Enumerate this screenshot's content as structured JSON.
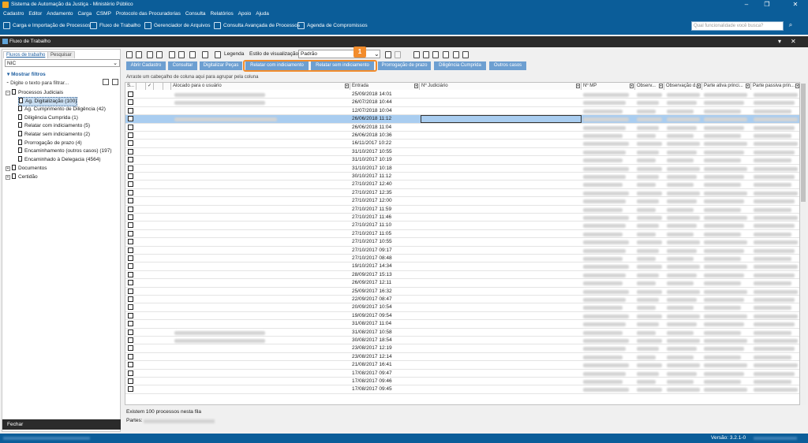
{
  "window": {
    "title": "Sistema de Automação da Justiça - Ministério Público"
  },
  "menu": [
    "Cadastro",
    "Editor",
    "Andamento",
    "Carga",
    "CSMP",
    "Protocolo das Procuradorias",
    "Consulta",
    "Relatórios",
    "Apoio",
    "Ajuda"
  ],
  "toolbar": {
    "items": [
      "Carga e Importação de Processos",
      "Fluxo de Trabalho",
      "Gerenciador de Arquivos",
      "Consulta Avançada de Processos",
      "Agenda de Compromissos"
    ],
    "search_placeholder": "Qual funcionalidade você busca?"
  },
  "panel": {
    "title": "Fluxo de Trabalho"
  },
  "left": {
    "tabs": [
      "Fluxos de trabalho",
      "Pesquisar"
    ],
    "selector_value": "NIC",
    "filters_label": "Mostrar filtros",
    "filter_placeholder": "Digite o texto para filtrar...",
    "tree_root": "Processos Judiciais",
    "tree_items": [
      "Ag. Digitalização (100)",
      "Ag. Cumprimento de Diligência (42)",
      "Diligência Cumprida (1)",
      "Relatar com indiciamento (5)",
      "Relatar sem indiciamento (2)",
      "Prorrogação de prazo (4)",
      "Encaminhamento (outros casos) (197)",
      "Encaminhado à Delegacia (4564)"
    ],
    "tree_other": [
      "Documentos",
      "Certidão"
    ],
    "close_label": "Fechar"
  },
  "main": {
    "legend_label": "Legenda",
    "style_label": "Estilo de visualização",
    "style_value": "Padrão",
    "buttons": [
      "Abrir Cadastro",
      "Consultar",
      "Digitalizar Peças",
      "Relatar com indiciamento",
      "Relatar sem indiciamento",
      "Prorrogação de prazo",
      "Diligência Cumprida",
      "Outros casos"
    ],
    "annotation_number": "1",
    "group_hint": "Arraste um cabeçalho de coluna aqui para agrupar pela coluna",
    "columns": [
      "S...",
      "Alocado para o usuário",
      "Entrada",
      "Nº Judiciário",
      "Nº MP",
      "Observ...",
      "Observação d...",
      "Parte ativa princi...",
      "Parte passiva prin..."
    ],
    "dates": [
      "25/09/2018 14:01",
      "26/07/2018 10:44",
      "12/07/2018 10:04",
      "26/06/2018 11:12",
      "26/06/2018 11:04",
      "26/06/2018 10:36",
      "16/11/2017 10:22",
      "31/10/2017 10:55",
      "31/10/2017 10:19",
      "31/10/2017 10:18",
      "30/10/2017 11:12",
      "27/10/2017 12:40",
      "27/10/2017 12:35",
      "27/10/2017 12:00",
      "27/10/2017 11:59",
      "27/10/2017 11:46",
      "27/10/2017 11:10",
      "27/10/2017 11:05",
      "27/10/2017 10:55",
      "27/10/2017 09:17",
      "27/10/2017 08:48",
      "19/10/2017 14:34",
      "28/09/2017 15:13",
      "26/09/2017 12:11",
      "25/09/2017 16:32",
      "22/09/2017 08:47",
      "20/09/2017 10:54",
      "19/09/2017 09:54",
      "31/08/2017 11:04",
      "31/08/2017 10:58",
      "30/08/2017 18:54",
      "23/08/2017 12:19",
      "23/08/2017 12:14",
      "21/08/2017 16:41",
      "17/08/2017 09:47",
      "17/08/2017 09:46",
      "17/08/2017 09:45"
    ],
    "selected_row": 3,
    "footer_count": "Existem 100 processos nesta fila",
    "footer_parts_label": "Partes:"
  },
  "status": {
    "version": "Versão: 3.2.1-0"
  },
  "colors": {
    "chrome": "#0b5d99",
    "button": "#6d9fd1",
    "highlight": "#f28c2c",
    "selection": "#a9cdf0"
  }
}
